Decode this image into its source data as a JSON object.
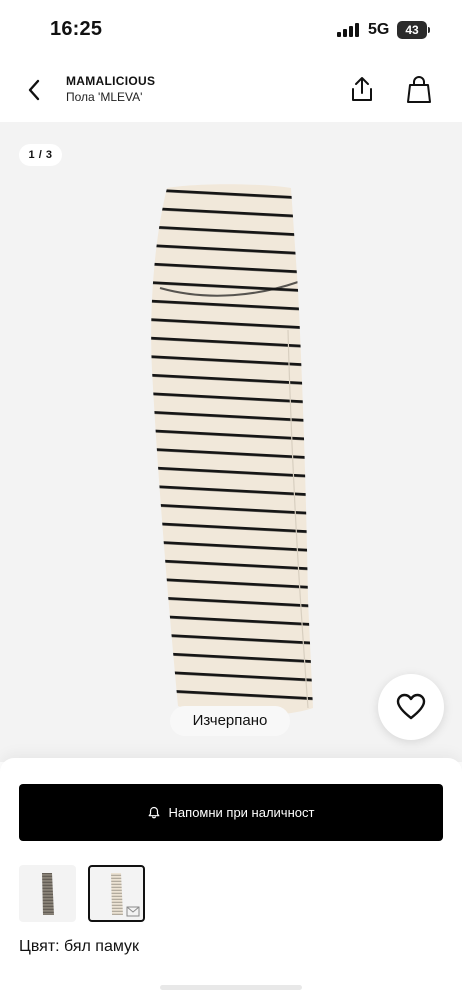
{
  "status_bar": {
    "time": "16:25",
    "network": "5G",
    "battery_level": "43",
    "icons": [
      "signal-icon",
      "battery-icon"
    ]
  },
  "header": {
    "brand": "MAMALICIOUS",
    "product_name": "Пола 'MLEVA'",
    "icons": [
      "chevron-left-icon",
      "share-icon",
      "shopping-bag-icon"
    ]
  },
  "gallery": {
    "page_indicator": "1 / 3",
    "current_page": 1,
    "total_pages": 3,
    "availability_badge": "Изчерпано",
    "wishlist_icon": "heart-icon",
    "product_colors": {
      "base": "#f1e8da",
      "stripe": "#151515"
    }
  },
  "purchase": {
    "notify_button_label": "Напомни при наличност",
    "notify_icon": "bell-icon",
    "notify_button_color": "#000000"
  },
  "variants": {
    "thumbnails": [
      {
        "name": "grey-striped-variant",
        "selected": false
      },
      {
        "name": "white-cotton-variant",
        "selected": true,
        "icon": "reminder-mail-icon"
      }
    ],
    "color_label": "Цвят: бял памук"
  }
}
